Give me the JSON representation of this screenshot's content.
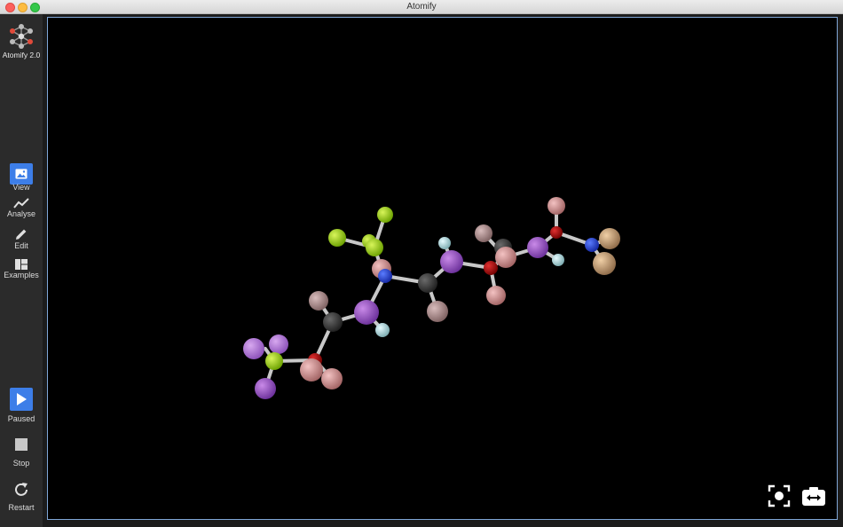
{
  "window": {
    "title": "Atomify"
  },
  "sidebar": {
    "logo_label": "Atomify 2.0",
    "nav": [
      {
        "label": "View",
        "icon": "image-icon",
        "active": true
      },
      {
        "label": "Analyse",
        "icon": "line-chart-icon"
      },
      {
        "label": "Edit",
        "icon": "pencil-icon"
      },
      {
        "label": "Examples",
        "icon": "grid-icon"
      }
    ],
    "controls": [
      {
        "label": "Paused",
        "icon": "play-icon"
      },
      {
        "label": "Stop",
        "icon": "stop-icon"
      },
      {
        "label": "Restart",
        "icon": "restart-icon"
      }
    ]
  },
  "viewport": {
    "buttons": [
      {
        "icon": "focus-icon"
      },
      {
        "icon": "camera-swap-icon"
      }
    ]
  },
  "colors": {
    "accent": "#3d7ee8",
    "viewport_background": "#000000",
    "sidebar_background": "#2b2b2b",
    "atom_purple": "#8f4fbf",
    "atom_green": "#8fd100",
    "atom_pink": "#c48f8f",
    "atom_blue": "#2246c8",
    "atom_red": "#b00000",
    "atom_dark": "#3a3a3a",
    "atom_tan": "#c9a27c",
    "atom_lightblue": "#a7d4d8"
  }
}
